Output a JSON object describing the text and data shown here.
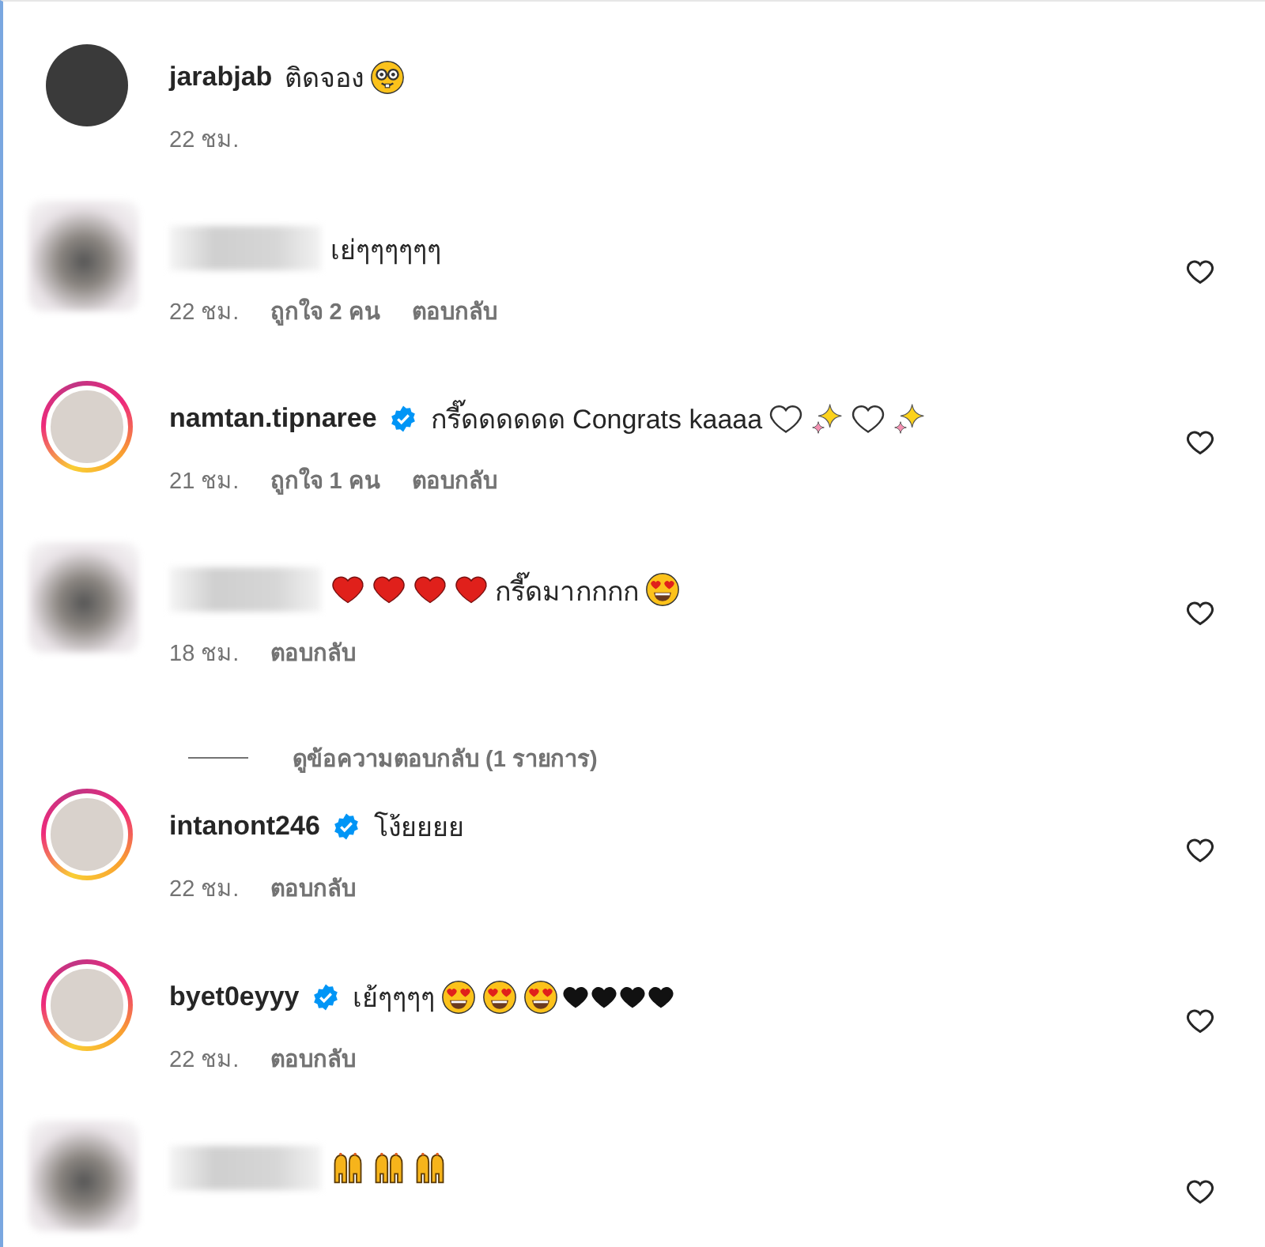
{
  "comments": [
    {
      "blurred": false,
      "story_ring": false,
      "like_button": false,
      "username": "jarabjab",
      "verified": false,
      "body": [
        {
          "kind": "text",
          "text": "ติดจอง"
        },
        {
          "kind": "nerd"
        }
      ],
      "meta": [
        "22 ชม."
      ]
    },
    {
      "blurred": true,
      "story_ring": false,
      "like_button": true,
      "verified": false,
      "body": [
        {
          "kind": "text",
          "text": "เย่ๆๆๆๆๆๆ"
        }
      ],
      "meta": [
        "22 ชม.",
        "ถูกใจ 2 คน",
        "ตอบกลับ"
      ]
    },
    {
      "blurred": false,
      "story_ring": true,
      "like_button": true,
      "username": "namtan.tipnaree",
      "verified": true,
      "body": [
        {
          "kind": "text",
          "text": "กรี๊ดดดดดด Congrats kaaaa"
        },
        {
          "kind": "whiteheart"
        },
        {
          "kind": "sparkles"
        },
        {
          "kind": "whiteheart"
        },
        {
          "kind": "sparkles"
        }
      ],
      "meta": [
        "21 ชม.",
        "ถูกใจ 1 คน",
        "ตอบกลับ"
      ]
    },
    {
      "blurred": true,
      "story_ring": false,
      "like_button": true,
      "verified": false,
      "body": [
        {
          "kind": "redheart"
        },
        {
          "kind": "redheart"
        },
        {
          "kind": "redheart"
        },
        {
          "kind": "redheart"
        },
        {
          "kind": "text",
          "text": "กรี๊ดมากกกก"
        },
        {
          "kind": "hearteyes"
        }
      ],
      "meta": [
        "18 ชม.",
        "ตอบกลับ"
      ],
      "view_replies": "ดูข้อความตอบกลับ (1 รายการ)"
    },
    {
      "blurred": false,
      "story_ring": true,
      "like_button": true,
      "username": "intanont246",
      "verified": true,
      "body": [
        {
          "kind": "text",
          "text": "โง้ยยยย"
        }
      ],
      "meta": [
        "22 ชม.",
        "ตอบกลับ"
      ]
    },
    {
      "blurred": false,
      "story_ring": true,
      "like_button": true,
      "username": "byet0eyyy",
      "verified": true,
      "body": [
        {
          "kind": "text",
          "text": "เย้ๆๆๆๆ"
        },
        {
          "kind": "hearteyes"
        },
        {
          "kind": "hearteyes"
        },
        {
          "kind": "hearteyes"
        },
        {
          "kind": "blackheart"
        },
        {
          "kind": "blackheart"
        },
        {
          "kind": "blackheart"
        },
        {
          "kind": "blackheart"
        }
      ],
      "meta": [
        "22 ชม.",
        "ตอบกลับ"
      ]
    },
    {
      "blurred": true,
      "story_ring": false,
      "like_button": true,
      "verified": false,
      "body": [
        {
          "kind": "raisedhands"
        },
        {
          "kind": "raisedhands"
        },
        {
          "kind": "raisedhands"
        }
      ]
    }
  ]
}
